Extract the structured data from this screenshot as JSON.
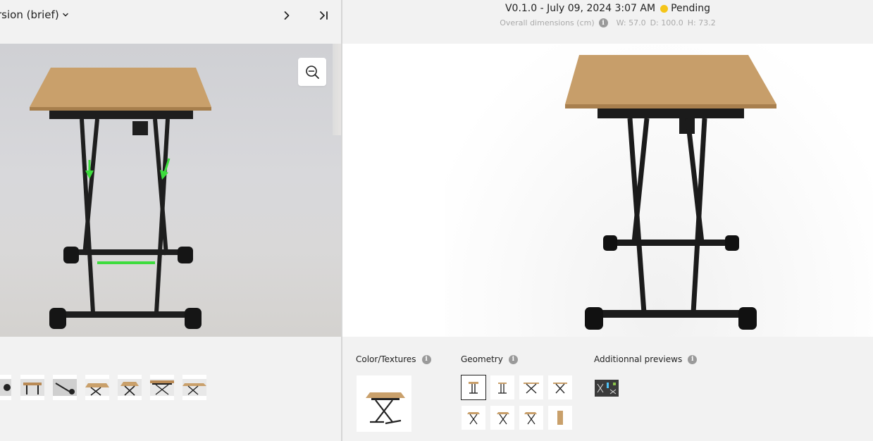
{
  "left_panel": {
    "version_select_label": "rsion (brief)",
    "icons": {
      "dropdown": "chevron-down-icon",
      "next": "chevron-right-icon",
      "last": "skip-to-end-icon",
      "zoom": "zoom-out-icon"
    },
    "thumbnail_count": 8
  },
  "right_panel": {
    "version": "V0.1.0 - July 09, 2024 3:07 AM",
    "status": "Pending",
    "status_color": "#f5c518",
    "dimensions_label": "Overall dimensions (cm)",
    "width": "W: 57.0",
    "depth": "D: 100.0",
    "height": "H: 73.2",
    "sections": {
      "color_textures": "Color/Textures",
      "geometry": "Geometry",
      "additional_previews": "Additionnal previews"
    },
    "info_icon_glyph": "i"
  },
  "colors": {
    "accent_green": "#3ddc3d",
    "wood": "#c9a06b",
    "frame": "#1e1e1e"
  }
}
